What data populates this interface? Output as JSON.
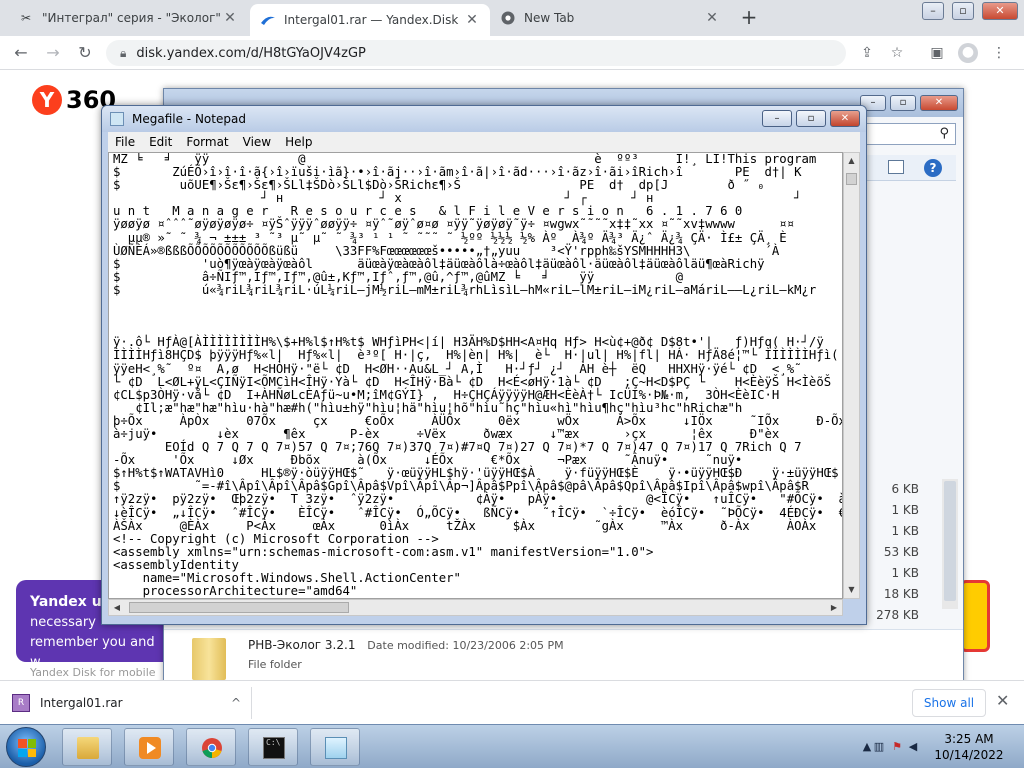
{
  "browser": {
    "tabs": [
      {
        "title": "\"Интеграл\" серия - \"Эколог\" - П",
        "favicon": "tools-icon"
      },
      {
        "title": "Intergal01.rar — Yandex.Disk",
        "favicon": "yandex-disk-icon",
        "active": true
      },
      {
        "title": "New Tab",
        "favicon": "chrome-icon"
      }
    ],
    "url": "disk.yandex.com/d/H8tGYaOJV4zGP"
  },
  "page": {
    "logo_letter": "Y",
    "logo_text": "360",
    "cookie_title": "Yandex u",
    "cookie_line1": "necessary",
    "cookie_line2": "remember you and w",
    "mobile_note": "Yandex Disk for mobile"
  },
  "explorer": {
    "sizes": [
      "6 KB",
      "1 KB",
      "1 KB",
      "53 KB",
      "1 KB",
      "18 KB",
      "278 KB"
    ],
    "folder_name": "PHB-Эколог 3.2.1",
    "folder_date_label": "Date modified: 10/23/2006 2:05 PM",
    "folder_type": "File folder"
  },
  "notepad": {
    "title": "Megafile - Notepad",
    "menu": [
      "File",
      "Edit",
      "Format",
      "View",
      "Help"
    ],
    "content": "MZ ╘   ╛   ÿÿ            @                                       è  ºº³     Í!¸ LÍ!This program\n$       ZúÉÕ›î›î·î·ã{›î›ïuši·ìã}·•›î·ãj··›î·ãm›î·ã|›î·ãd···›î·ãz›î·ãi›îRich›î       PE  d†| K\n$        uõUE¶›Šε¶›Šε¶›ŠLl‡ŠDò›ŠLl$Dò›ŠRichε¶›Š                PE  d†  dp[J        ð ˝ ₀\n                    ┘ н             ┘ х                      ┘ ┌      ┘ н                   ┘\nu n t   M a n a g e r   R e s o u r c e s   & l F i l e V e r s i o n   6 . 1 . 7 6 0\nÿøøÿø ¤ˆˆˆ˜øÿøÿøÿø÷ ¤ÿŠˆÿÿÿˆøøÿÿ÷ ¤ÿˆ˜øÿˆø¤ø ¤ÿÿ˜ÿøÿøÿ˜ÿ÷ ¤wgwx˜˜˜˜x‡‡˜xx ¤˜˜xv‡wwww      ¤¤\n  µµ® »˜ ˜ ¾ ¬ ±±± ³ ˜³ µ˜ µ˜ ˜ ¾³ ¹ ¹ ˜ ˜˜˜ ˜ ½ºº ½½½ ½% Àº  À¾º Ä¾³ Ä¿ˆ Ä¿¾ ÇÄ· Ì£± ÇÄ¸ È\nÙØÑÈÁ»®ßßßÕÕÕÕÕÕÕÕÕÕÕßüßü     \\33FF%Fœœœœœœš•••••„†„yuu    ³<Ÿ'rpph‰šYSMHHHH3\\          ´À\n$           'uò¶ÿœàÿœàÿœàôl      äüœàÿœàœàôl‡äüœàôlà÷œàôl‡äüœàôl·äüœàôl‡äüœàôläü¶œàRichÿ\n$           â÷ÑIƒ™,Iƒ™,Iƒ™,@û±,Kƒ™,Iƒˆ,ƒ™,@û,^ƒ™,@ûMZ ╘   ╛    ÿÿ           @\n$           ú«¾riL¾riL¾riL·úL¼riL–jM½riL–mM±riL¾rhLìsìL–hM«riL–lM±riL–iM¿riL–aMáriL––L¿riL–kM¿r\n\n\n\nÿ·.ô└ HƒÀ@[ÀÌÌÌÌÌÌÌÌH%\\$+H%l$↑H%t$ WHƒìPH<|í| H3ÄH%D$HH<A¤Hq Hƒ> H<ù¢+@ð¢ D$8t•'|   ƒ)Hƒq( H·┘/ÿ\nÌÌÌÌHƒì8HÇD$ þÿÿÿHƒ%«l|  Hƒ%«l|  è³º[ H·|ç,  H%|èn| H%|  è└  H·|ul| H%|fl| HÁ· HƒÄ8é¦™└ ÌÌÌÌÌÌHƒì(\nÿÿeH<¸%˜  º¤  A,ø  H<HÒHÿ·\"ë└ ¢D  H<ØH··Au&L_┘ A,Ì   H·┘ƒ┘ ¿┘  ÀH è┼  ëQ   HHXHÿ·ÿé└ ¢D  <¸%˜\n└ ¢D  L<ØL+ÿL<ÇIÑÿI<ÕMCìH<ÎHÿ·Yà└ ¢D  H<ÎHÿ·Bà└ ¢D  H<É<øHÿ·1à└ ¢D   ;Ç~H<D$PÇ └    H<ÈèÿŠ H<ÌèõŠ\n¢CL$p3ÒHÿ·vå└ ¢D  I+ÀHÑøLcÈAƒü~u•M;îM¢GÝI} ,  H÷ÇHÇÁÿÿÿÿH@ÆH<ÈèÀ†└ IcÜI%·Þ№·m,  3ÒH<ÈèIC·H\n   ¢Il;æ\"hæ\"hæ\"hìu·hà\"hæ#h(\"hìu±hÿ\"hìu¦hä\"hìu¦hõ\"hìu˜hç\"hìu«hì\"hìu¶hç\"hìu³hc\"hRichæ\"h\nþ÷Õx     ÀpÒx     07Õx     çx     €oÕx     ÀÜÕx     0ëx     wÖx     À>Õx     ↓IÖx     ˜IÕx     Ð-Õx\nà÷juÿ•        ↓èx      ¶êx      P-èx     ÷Vëx     ðwæx     ↓™æx      ›çx      ¦êx     Ð\"èx\n       EOÍd Q 7 Q 7 Q 7¤)57 Q 7¤;76Q 7¤)37Q 7¤)#7¤Q 7¤)27 Q 7¤)*7 Q 7¤)47 Q 7¤)17 Q 7Rich Q 7\n-Õx     'Õx     ↓Øx     Ðbõx     à(Õx     ↓ÉÕx     €*Õx     ¬Pæx     ˜Ânuÿ•     ˜nuÿ•\n$↑H%t$↑WATAVHì0     HL$®ÿ·òüÿÿHŒ$˜   ÿ·œüÿÿHL$hÿ·'üÿÿHŒ$À    ÿ·füÿÿHŒ$È    ÿ·•üÿÿHŒ$Ð    ÿ·±üÿÿHŒ$\n$          ˜=-#î\\Âpî\\Âpî\\Âpâ$Gpî\\Âpâ$Vpî\\Âpî\\Âp¬]Âpâ$Ppî\\Âpâ$@pâ\\Âpâ$Qpî\\Âpâ$Ipî\\Âpâ$wpî\\Âpâ$R\n↑ÿ2zÿ•  pÿ2zÿ•  Œþ2zÿ•  T 3zÿ•  ˆÿ2zÿ•           ¢Àÿ•   pÀÿ•            @<ÎCÿ•   ↑uÎCÿ•   \"#ÕCÿ•  àr]\n↓èÎCÿ•  „↓ÎCÿ•  ˆ#ÎCÿ•   ÈÎCÿ•   ˆ#ÎCÿ•  Ó„ÕCÿ•   ßÑCÿ•   ˜↑ÎCÿ•  `÷ÎCÿ•  èóÎCÿ•  ˜ÞÕCÿ•  4ÉÐCÿ•  €\nÀŠÀx     @ÈÀx     P<Àx     œÀx      0ìÀx     tŽÀx     $Àx        ˜gÀx     ™Àx     ð-Àx     ÀOÀx     ÀvÀx\n<!-- Copyright (c) Microsoft Corporation -->\n<assembly xmlns=\"urn:schemas-microsoft-com:asm.v1\" manifestVersion=\"1.0\">\n<assemblyIdentity\n    name=\"Microsoft.Windows.Shell.ActionCenter\"\n    processorArchitecture=\"amd64\""
  },
  "downloads": {
    "file": "Intergal01.rar",
    "show_all": "Show all"
  },
  "taskbar": {
    "time": "3:25 AM",
    "date": "10/14/2022"
  },
  "colors": {
    "yandex_red": "#fc3f1d",
    "cookie_purple": "#5e35b1",
    "link_blue": "#1a73e8"
  }
}
